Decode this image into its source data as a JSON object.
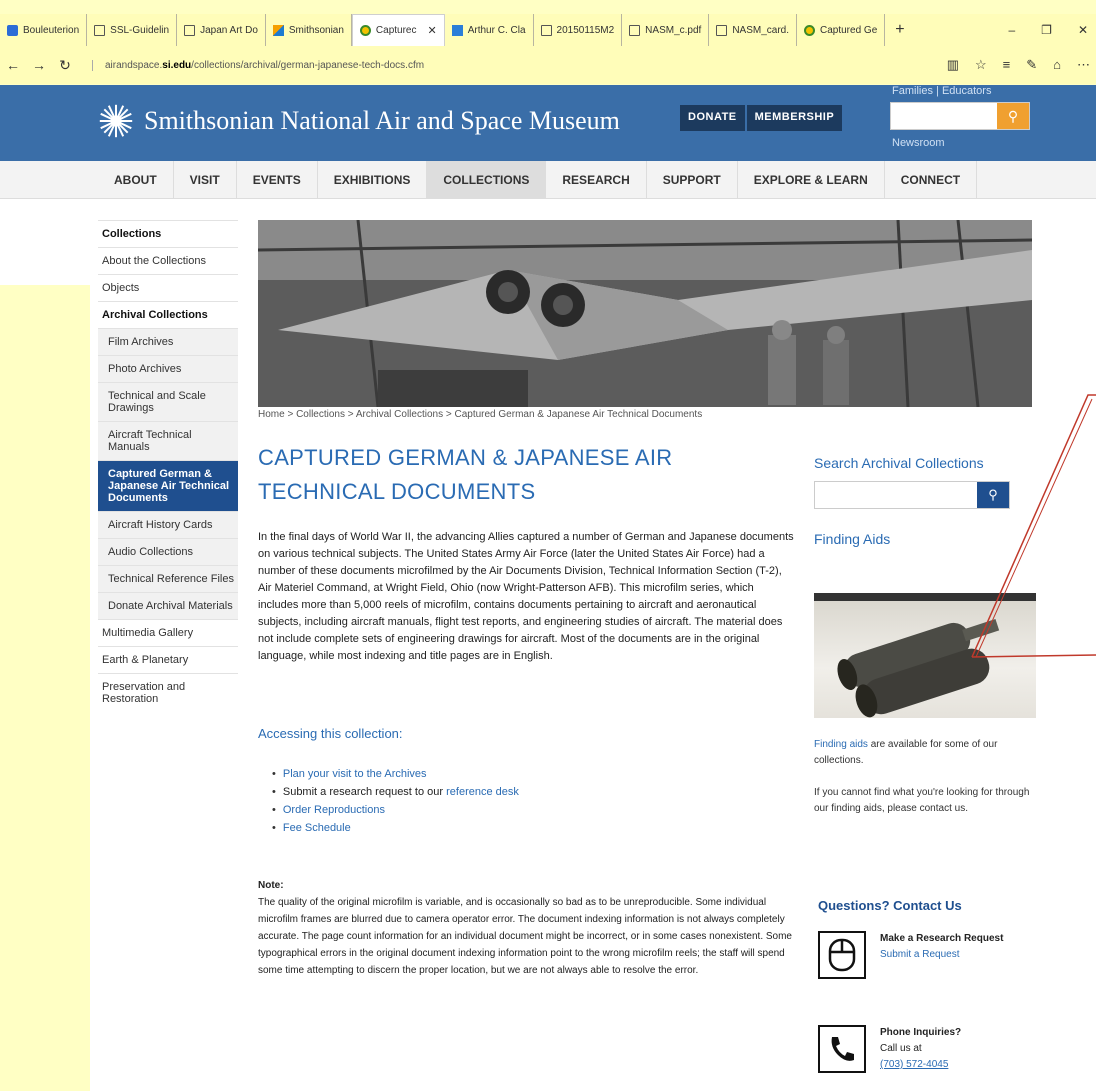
{
  "browser": {
    "tabs": [
      {
        "label": "Bouleuterion",
        "icon": "fav-blue"
      },
      {
        "label": "SSL-Guidelin",
        "icon": "fav-doc"
      },
      {
        "label": "Japan Art Do",
        "icon": "fav-doc"
      },
      {
        "label": "Smithsonian",
        "icon": "fav-ss"
      },
      {
        "label": "Capturec",
        "icon": "fav-sun",
        "active": true
      },
      {
        "label": "Arthur C. Cla",
        "icon": "fav-wiki"
      },
      {
        "label": "20150115M2",
        "icon": "fav-doc"
      },
      {
        "label": "NASM_c.pdf",
        "icon": "fav-doc"
      },
      {
        "label": "NASM_card.",
        "icon": "fav-doc"
      },
      {
        "label": "Captured Ge",
        "icon": "fav-sun"
      }
    ],
    "url_prefix": "airandspace.",
    "url_domain": "si.edu",
    "url_path": "/collections/archival/german-japanese-tech-docs.cfm"
  },
  "header": {
    "site_name": "Smithsonian National Air and Space Museum",
    "donate": "DONATE",
    "membership": "MEMBERSHIP",
    "families": "Families",
    "educators": "Educators",
    "newsroom": "Newsroom"
  },
  "nav": [
    "ABOUT",
    "VISIT",
    "EVENTS",
    "EXHIBITIONS",
    "COLLECTIONS",
    "RESEARCH",
    "SUPPORT",
    "EXPLORE & LEARN",
    "CONNECT"
  ],
  "sidebar": [
    {
      "label": "Collections",
      "type": "head"
    },
    {
      "label": "About the Collections",
      "type": "item"
    },
    {
      "label": "Objects",
      "type": "item"
    },
    {
      "label": "Archival Collections",
      "type": "head"
    },
    {
      "label": "Film Archives",
      "type": "sub"
    },
    {
      "label": "Photo Archives",
      "type": "sub"
    },
    {
      "label": "Technical and Scale Drawings",
      "type": "sub"
    },
    {
      "label": "Aircraft Technical Manuals",
      "type": "sub"
    },
    {
      "label": "Captured German & Japanese Air Technical Documents",
      "type": "active"
    },
    {
      "label": "Aircraft History Cards",
      "type": "sub"
    },
    {
      "label": "Audio Collections",
      "type": "sub"
    },
    {
      "label": "Technical Reference Files",
      "type": "sub"
    },
    {
      "label": "Donate Archival Materials",
      "type": "sub"
    },
    {
      "label": "Multimedia Gallery",
      "type": "item"
    },
    {
      "label": "Earth & Planetary",
      "type": "item"
    },
    {
      "label": "Preservation and Restoration",
      "type": "item"
    }
  ],
  "breadcrumb": "Home > Collections > Archival Collections > Captured German & Japanese Air Technical Documents",
  "page_title": "CAPTURED GERMAN & JAPANESE AIR TECHNICAL DOCUMENTS",
  "intro": "In the final days of World War II, the advancing Allies captured a number of German and Japanese documents on various technical subjects. The United States Army Air Force (later the United States Air Force) had a number of these documents microfilmed by the Air Documents Division, Technical Information Section (T-2), Air Materiel Command, at Wright Field, Ohio (now Wright-Patterson AFB). This microfilm series, which includes more than 5,000 reels of microfilm, contains documents pertaining to aircraft and aeronautical subjects, including aircraft manuals, flight test reports, and engineering studies of aircraft. The material does not include complete sets of engineering drawings for aircraft. Most of the documents are in the original language, while most indexing and title pages are in English.",
  "accessing": {
    "heading": "Accessing this collection:",
    "items": [
      {
        "text": "Plan your visit to the Archives",
        "link": true
      },
      {
        "prefix": "Submit a research request to our ",
        "link_text": "reference desk"
      },
      {
        "text": "Order Reproductions",
        "link": true
      },
      {
        "text": "Fee Schedule",
        "link": true
      }
    ]
  },
  "note": {
    "heading": "Note:",
    "text": "The quality of the original microfilm is variable, and is occasionally so bad as to be unreproducible. Some individual microfilm frames are blurred due to camera operator error. The document indexing information is not always completely accurate. The page count information for an individual document might be incorrect, or in some cases nonexistent. Some typographical errors in the original document indexing information point to the wrong microfilm reels; the staff will spend some time attempting to discern the proper location, but we are not always able to resolve the error."
  },
  "right": {
    "search_heading": "Search Archival Collections",
    "finding_heading": "Finding Aids",
    "finding_link": "Finding aids",
    "finding_text": " are available for some of our collections.",
    "contact_text": "If you cannot find what you're looking for through our finding aids, please contact us.",
    "questions_heading": "Questions? Contact Us",
    "research_title": "Make a Research Request",
    "research_link": "Submit a Request",
    "phone_title": "Phone Inquiries?",
    "phone_call": "Call us at",
    "phone_number": "(703) 572-4045"
  },
  "colors": {
    "brand_blue": "#3a6ea8",
    "link": "#2a6bb3",
    "active_nav": "#1f4f8f",
    "page_bg": "#ffffc4"
  }
}
